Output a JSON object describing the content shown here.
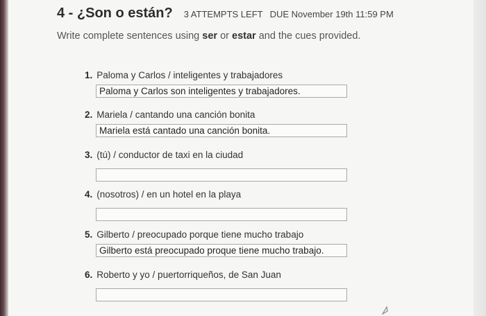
{
  "header": {
    "title": "4 - ¿Son o están?",
    "attempts": "3 ATTEMPTS LEFT",
    "due": "DUE  November 19th 11:59 PM"
  },
  "instructions": {
    "before": "Write complete sentences using ",
    "word1": "ser",
    "middle": " or ",
    "word2": "estar",
    "after": " and the cues provided."
  },
  "items": [
    {
      "num": "1.",
      "cue": "Paloma y Carlos / inteligentes y trabajadores",
      "answer": "Paloma y Carlos son inteligentes y trabajadores."
    },
    {
      "num": "2.",
      "cue": "Mariela / cantando una canción bonita",
      "answer": "Mariela está cantado una canción bonita."
    },
    {
      "num": "3.",
      "cue": "(tú) / conductor de taxi en la ciudad",
      "answer": ""
    },
    {
      "num": "4.",
      "cue": "(nosotros) / en un hotel en la playa",
      "answer": ""
    },
    {
      "num": "5.",
      "cue": "Gilberto / preocupado porque tiene mucho trabajo",
      "answer": "Gilberto está preocupado proque tiene mucho trabajo."
    },
    {
      "num": "6.",
      "cue": "Roberto y yo / puertorriqueños, de San Juan",
      "answer": ""
    }
  ]
}
